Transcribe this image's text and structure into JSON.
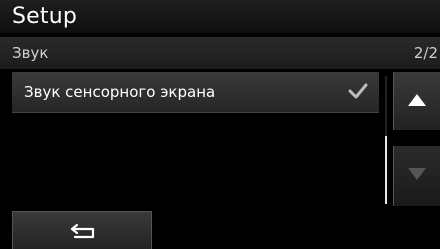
{
  "header": {
    "title": "Setup"
  },
  "section": {
    "title": "Звук",
    "page_indicator": "2/2"
  },
  "list": {
    "items": [
      {
        "label": "Звук сенсорного экрана",
        "checked": true
      }
    ]
  },
  "scrollbar": {
    "position_fraction": 0.5
  },
  "icons": {
    "check": "check-icon",
    "back": "back-arrow-icon",
    "up": "arrow-up-icon",
    "down": "arrow-down-icon"
  }
}
